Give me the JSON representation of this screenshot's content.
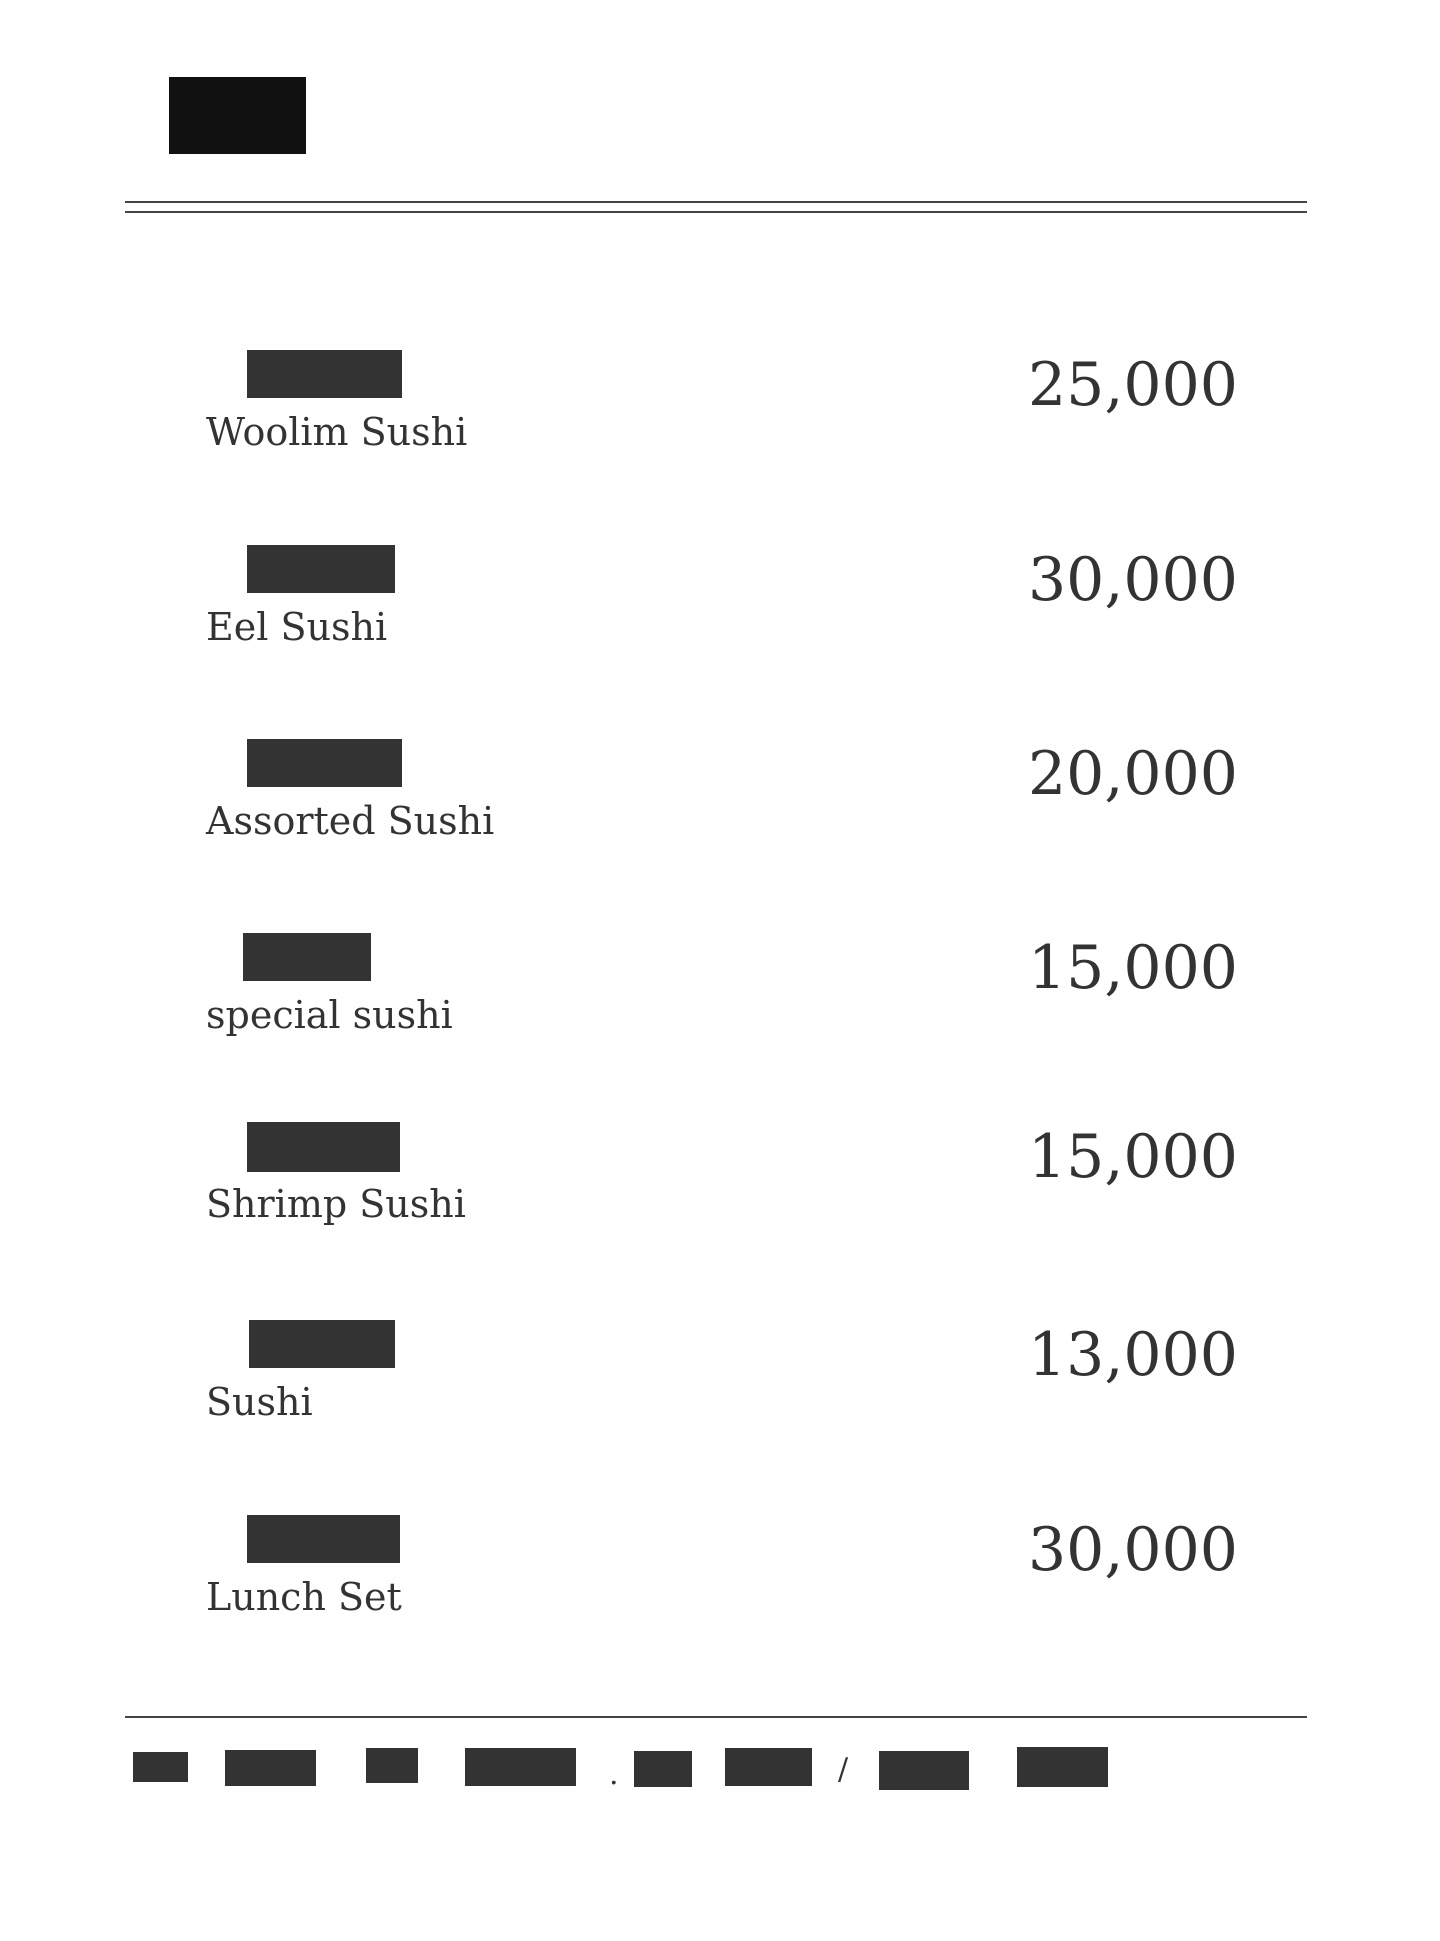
{
  "menu": {
    "items": [
      {
        "name": "Woolim Sushi",
        "price": "25,000"
      },
      {
        "name": "Eel Sushi",
        "price": "30,000"
      },
      {
        "name": "Assorted Sushi",
        "price": "20,000"
      },
      {
        "name": "special sushi",
        "price": "15,000"
      },
      {
        "name": "Shrimp Sushi",
        "price": "15,000"
      },
      {
        "name": "Sushi",
        "price": "13,000"
      },
      {
        "name": "Lunch Set",
        "price": "30,000"
      }
    ]
  },
  "footer": {
    "separator_1": ".",
    "separator_2": "/"
  }
}
